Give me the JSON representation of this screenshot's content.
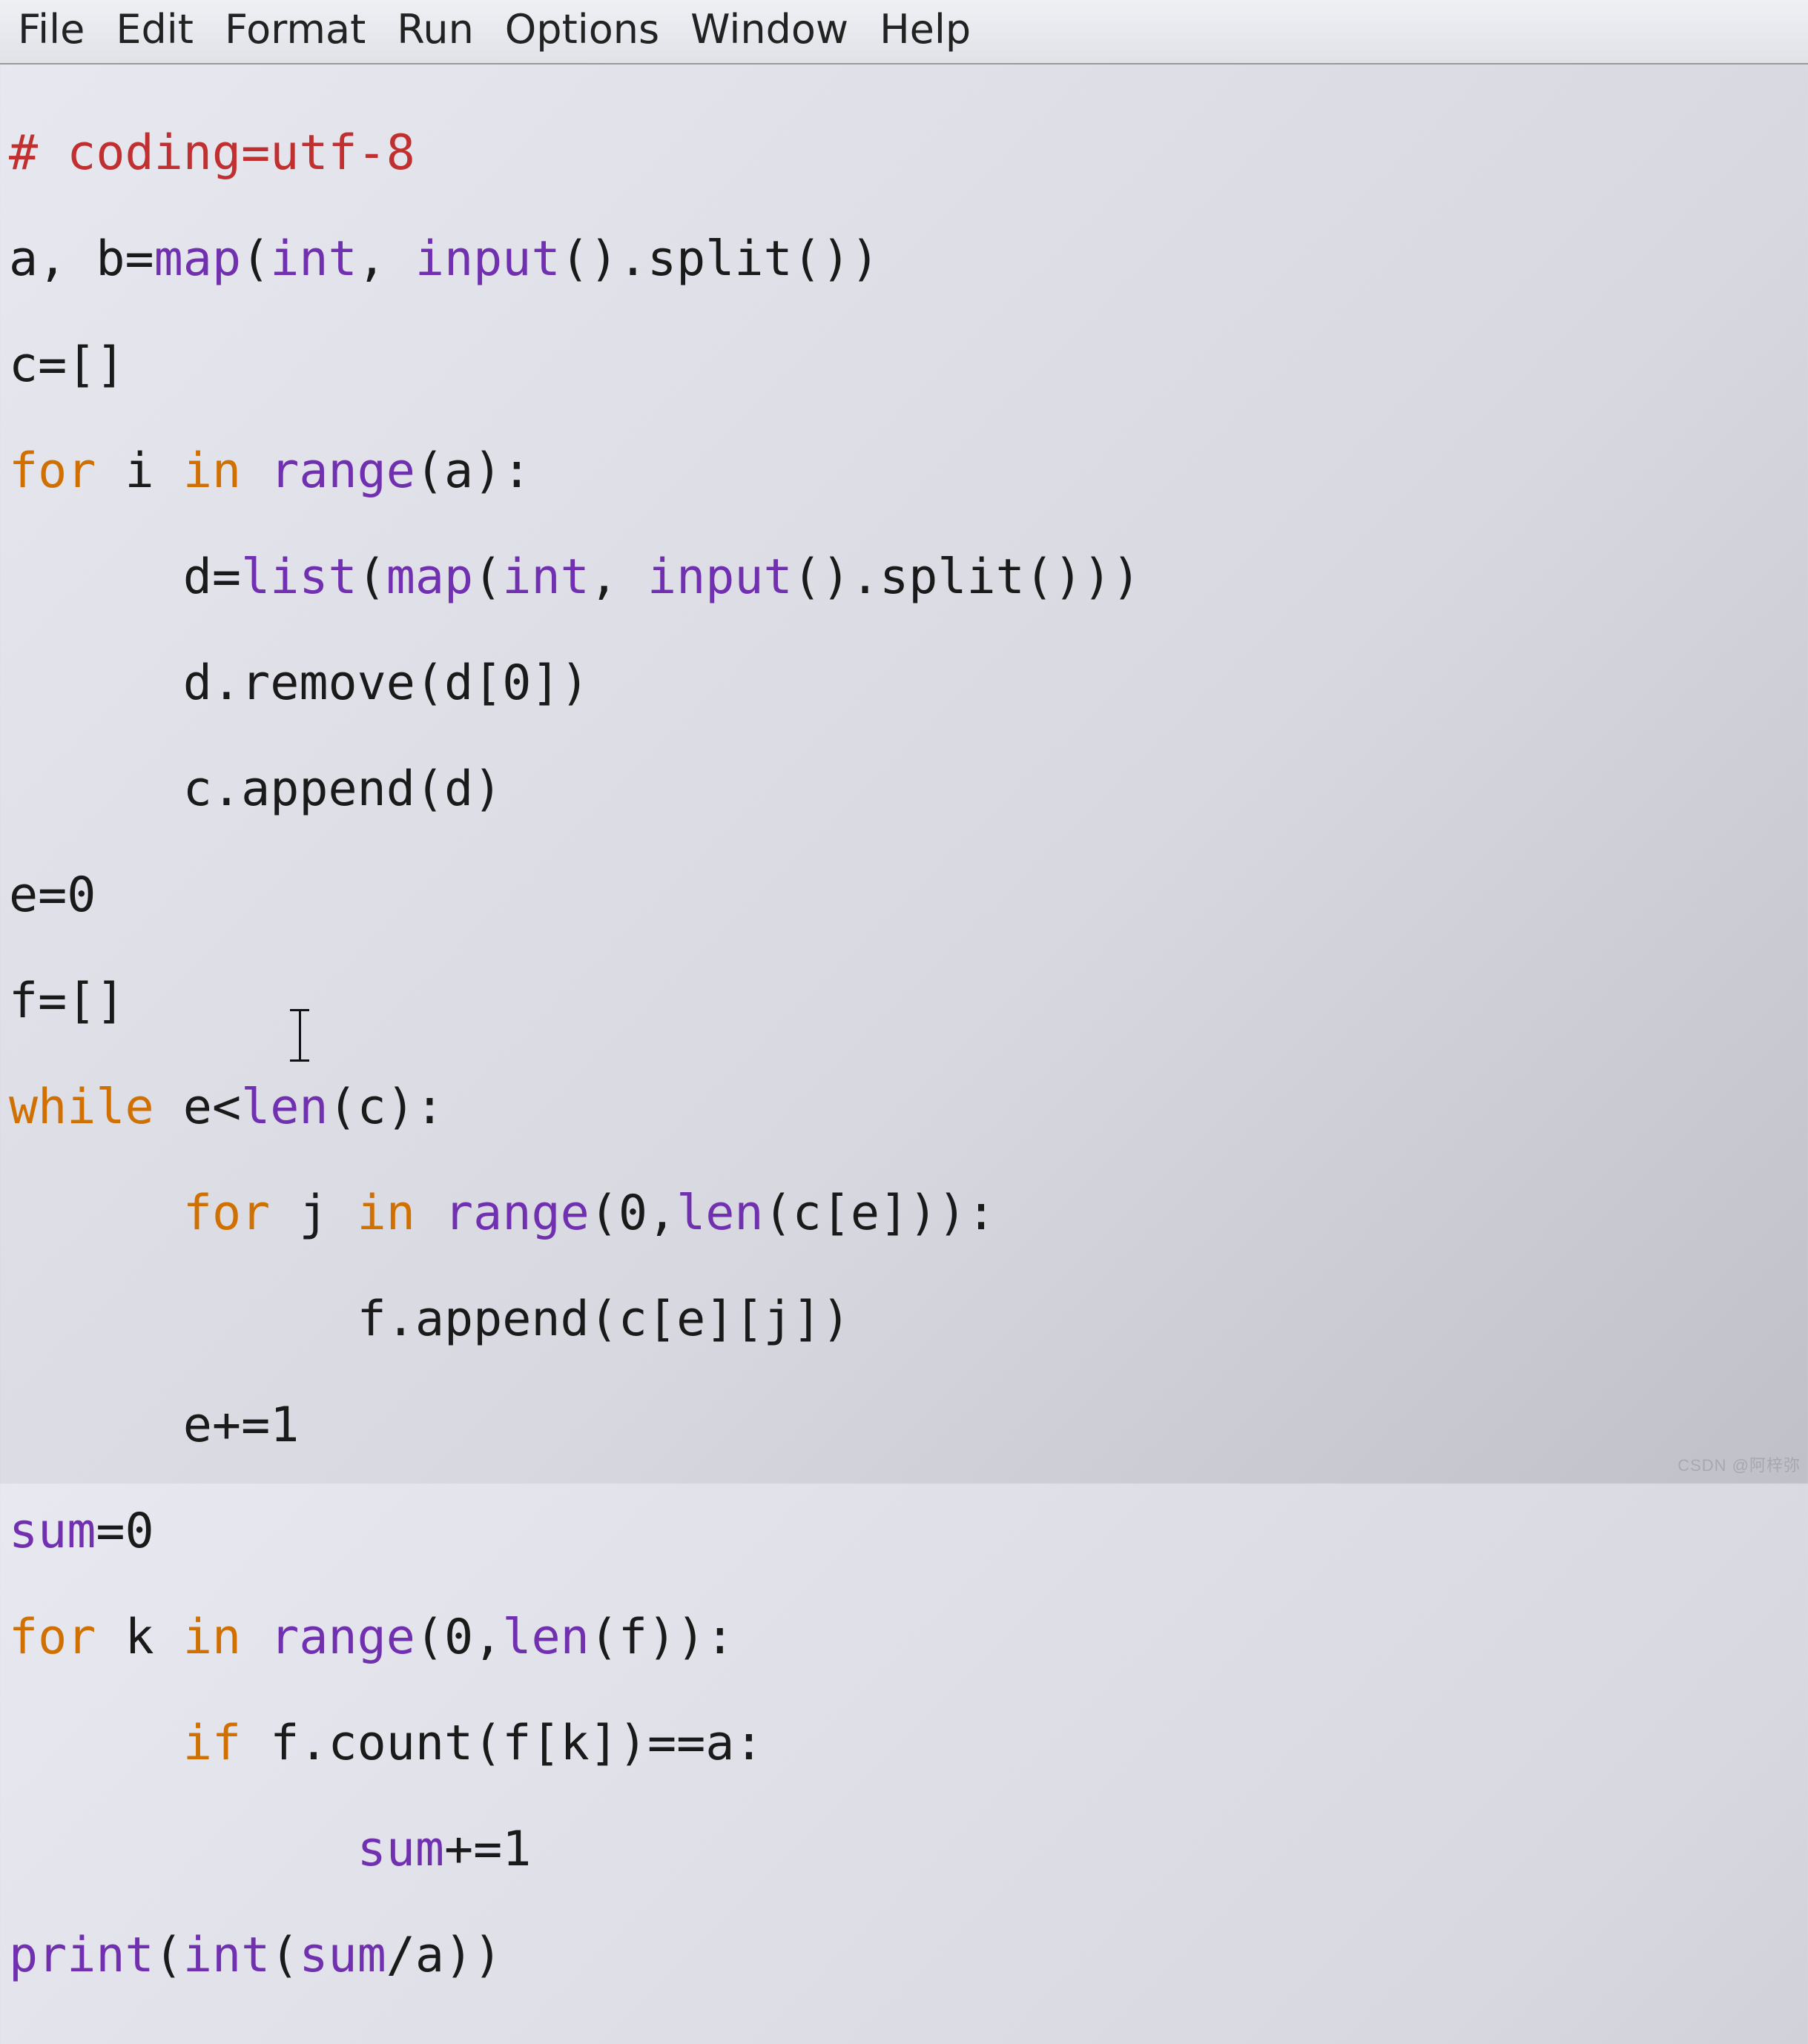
{
  "menu": {
    "file": "File",
    "edit": "Edit",
    "format": "Format",
    "run": "Run",
    "options": "Options",
    "window": "Window",
    "help": "Help"
  },
  "code": {
    "l1_comment": "# coding=utf-8",
    "l2_a": "a, b=",
    "l2_map": "map",
    "l2_b": "(",
    "l2_int": "int",
    "l2_c": ", ",
    "l2_input": "input",
    "l2_d": "().split())",
    "l3": "c=[]",
    "l4_for": "for",
    "l4_sp1": " i ",
    "l4_in": "in",
    "l4_sp2": " ",
    "l4_range": "range",
    "l4_rest": "(a):",
    "l5_ind": "      d=",
    "l5_list": "list",
    "l5_a": "(",
    "l5_map": "map",
    "l5_b": "(",
    "l5_int": "int",
    "l5_c": ", ",
    "l5_input": "input",
    "l5_d": "().split()))",
    "l6": "      d.remove(d[0])",
    "l7": "      c.append(d)",
    "l8": "e=0",
    "l9": "f=[]      ",
    "l10_while": "while",
    "l10_a": " e<",
    "l10_len": "len",
    "l10_b": "(c):",
    "l11_ind": "      ",
    "l11_for": "for",
    "l11_a": " j ",
    "l11_in": "in",
    "l11_b": " ",
    "l11_range": "range",
    "l11_c": "(0,",
    "l11_len": "len",
    "l11_d": "(c[e])):",
    "l12": "            f.append(c[e][j])",
    "l13": "      e+=1",
    "l14_a": "sum",
    "l14_b": "=0",
    "l15_for": "for",
    "l15_a": " k ",
    "l15_in": "in",
    "l15_b": " ",
    "l15_range": "range",
    "l15_c": "(0,",
    "l15_len": "len",
    "l15_d": "(f)):",
    "l16_ind": "      ",
    "l16_if": "if",
    "l16_rest": " f.count(f[k])==a:",
    "l17_ind": "            ",
    "l17_sum": "sum",
    "l17_rest": "+=1",
    "l18_print": "print",
    "l18_a": "(",
    "l18_int": "int",
    "l18_b": "(",
    "l18_sum": "sum",
    "l18_c": "/a))"
  },
  "watermark": "CSDN @阿梓弥"
}
